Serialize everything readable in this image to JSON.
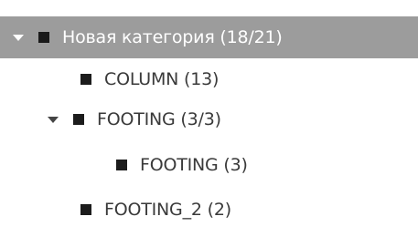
{
  "tree": {
    "root": {
      "label": "Новая категория (18/21)",
      "expanded": true,
      "selected": true,
      "children": [
        {
          "label": "COLUMN  (13)"
        },
        {
          "label": "FOOTING  (3/3)",
          "expanded": true,
          "children": [
            {
              "label": "FOOTING  (3)"
            }
          ]
        },
        {
          "label": "FOOTING_2  (2)"
        }
      ]
    }
  },
  "colors": {
    "selected_background": "#9c9c9c",
    "selected_text": "#ffffff",
    "text": "#3a3a3a",
    "square_icon": "#1c1c1c"
  }
}
